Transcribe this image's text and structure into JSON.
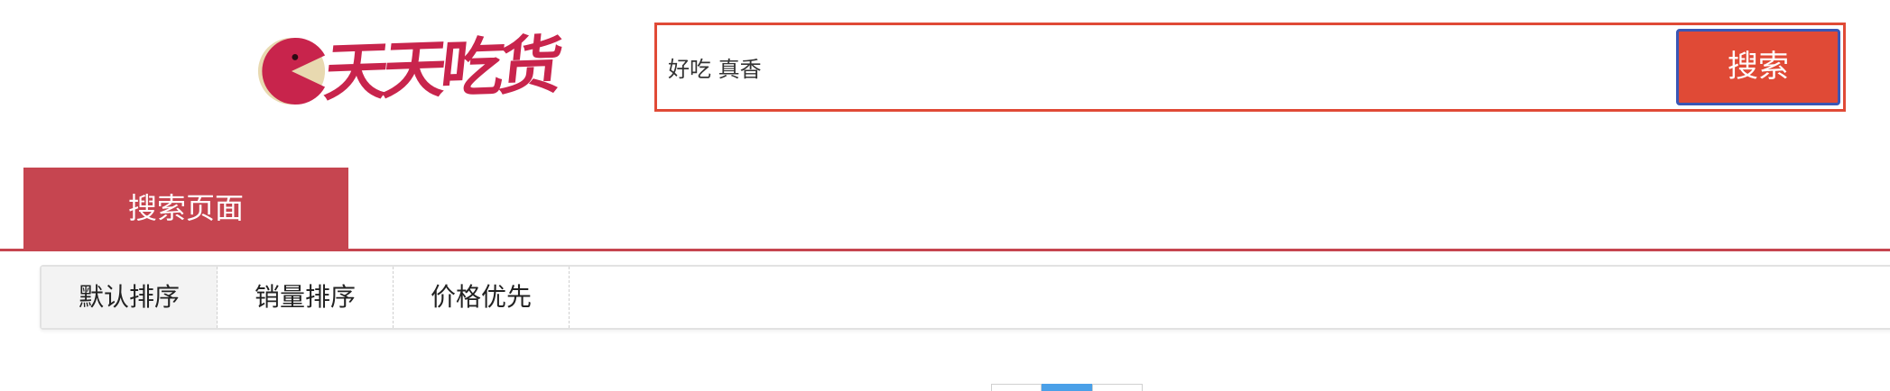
{
  "header": {
    "logo_text": "天天吃货",
    "colors": {
      "brand": "#c8244c",
      "search_accent": "#e04a36",
      "button_focus_border": "#3a56b5"
    }
  },
  "search": {
    "value": "好吃 真香",
    "button_label": "搜索"
  },
  "nav": {
    "active_tab_label": "搜索页面",
    "accent_color": "#c64550"
  },
  "sort": {
    "items": [
      {
        "label": "默认排序",
        "active": true
      },
      {
        "label": "销量排序",
        "active": false
      },
      {
        "label": "价格优先",
        "active": false
      }
    ]
  },
  "pagination": {
    "current_color": "#4aa0e8"
  }
}
